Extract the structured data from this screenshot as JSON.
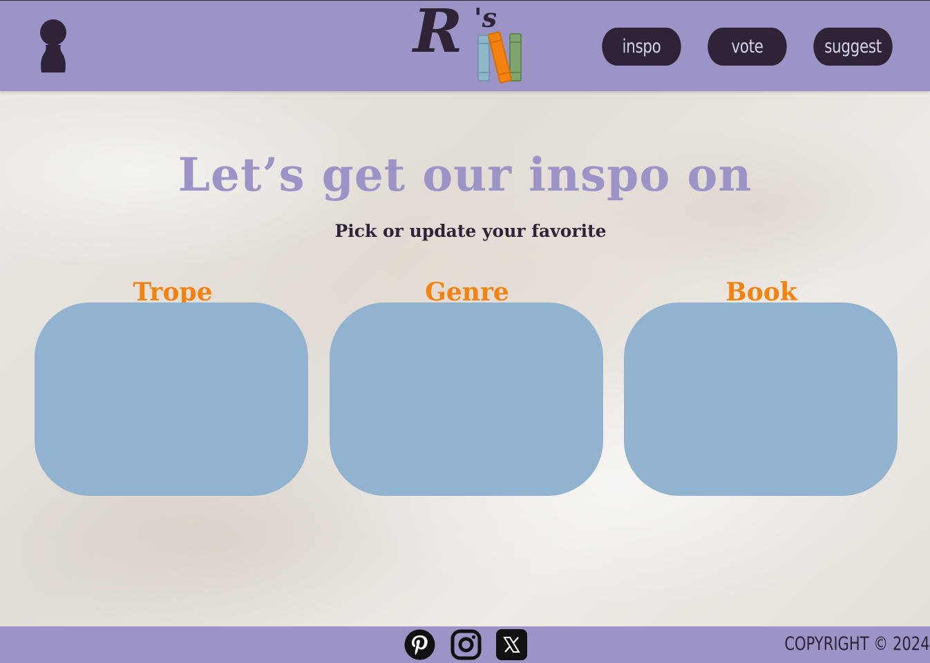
{
  "header": {
    "logo_text": "R",
    "logo_suffix": "'s",
    "nav": [
      {
        "label": "inspo"
      },
      {
        "label": "vote"
      },
      {
        "label": "suggest"
      }
    ]
  },
  "main": {
    "headline": "Let’s get our inspo on",
    "subheading": "Pick or update your favorite",
    "cards": [
      {
        "label": "Trope"
      },
      {
        "label": "Genre"
      },
      {
        "label": "Book"
      }
    ]
  },
  "footer": {
    "social": [
      "pinterest-icon",
      "instagram-icon",
      "x-icon"
    ],
    "copyright": "COPYRIGHT © 2024"
  },
  "colors": {
    "bar": "#9c94c6",
    "dark": "#2f2337",
    "accent": "#f3820f",
    "card": "#91b3cf"
  }
}
